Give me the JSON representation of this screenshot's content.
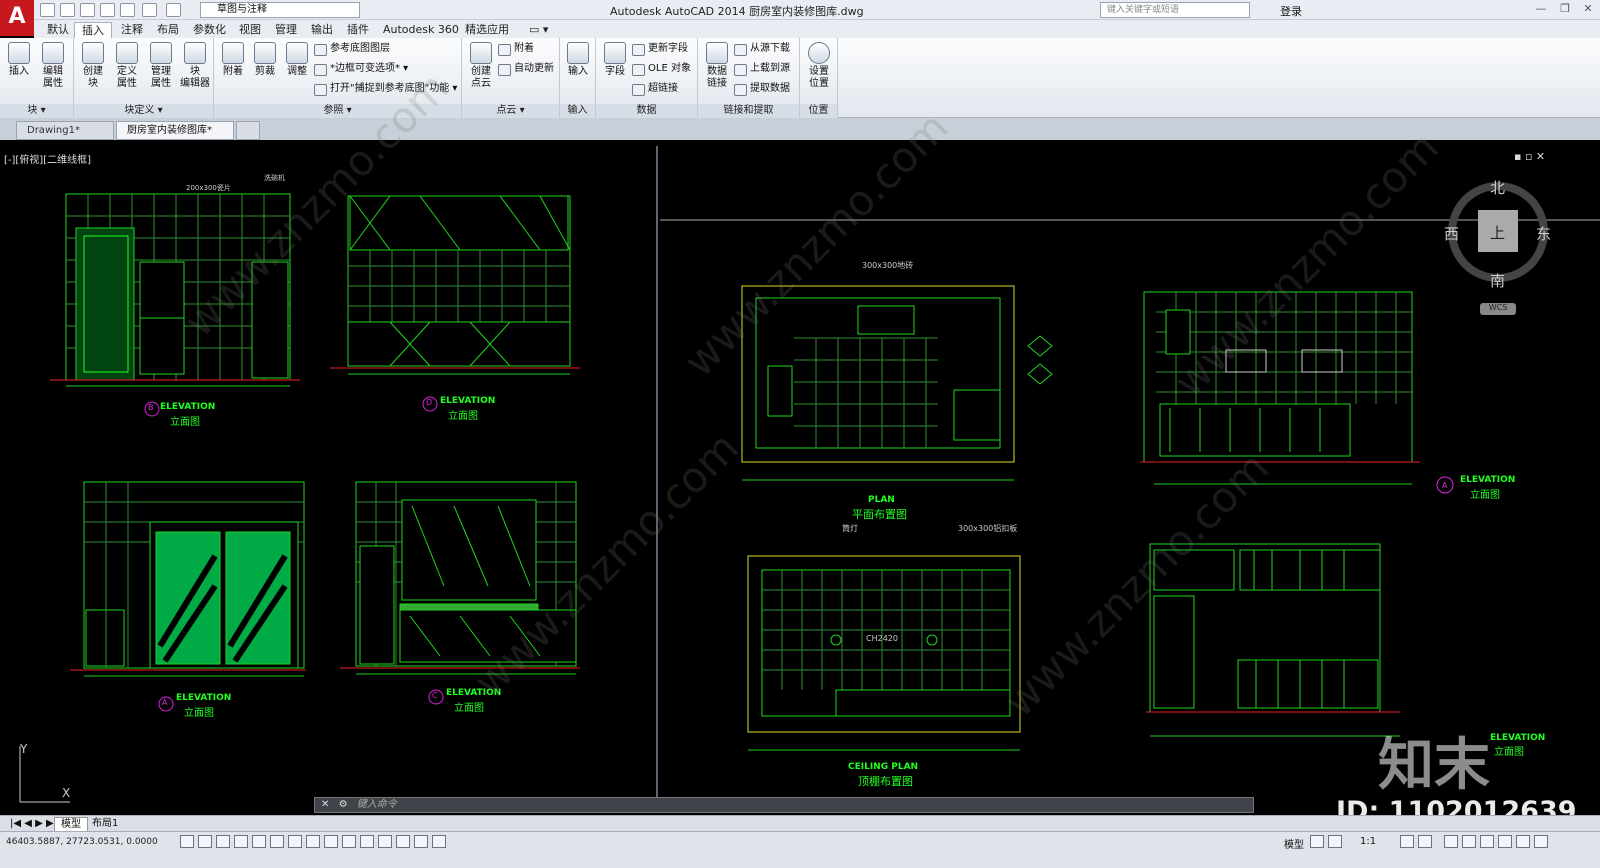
{
  "app": {
    "title": "Autodesk AutoCAD 2014    厨房室内装修图库.dwg",
    "logo": "A",
    "workspace": "草图与注释",
    "search_placeholder": "键入关键字或短语",
    "login": "登录",
    "window_controls": [
      "—",
      "❐",
      "✕"
    ]
  },
  "ribbon_tabs": [
    "默认",
    "插入",
    "注释",
    "布局",
    "参数化",
    "视图",
    "管理",
    "输出",
    "插件",
    "Autodesk 360",
    "精选应用",
    "▭ ▾"
  ],
  "active_ribbon_tab": "插入",
  "panels": {
    "block": {
      "title": "块 ▾",
      "buttons": [
        "插入",
        "编辑\n属性"
      ]
    },
    "block_def": {
      "title": "块定义 ▾",
      "buttons": [
        "创建\n块",
        "定义\n属性",
        "管理\n属性",
        "块\n编辑器"
      ]
    },
    "reference": {
      "title": "参照 ▾",
      "buttons": [
        "附着",
        "剪裁",
        "调整"
      ],
      "small": [
        "参考底图图层",
        "*边框可变选项* ▾",
        "打开\"捕捉到参考底图\"功能 ▾"
      ]
    },
    "pointcloud": {
      "title": "点云 ▾",
      "buttons": [
        "创建\n点云"
      ],
      "small": [
        "附着",
        "自动更新"
      ]
    },
    "import": {
      "title": "输入",
      "buttons": [
        "输入"
      ]
    },
    "data": {
      "title": "数据",
      "buttons": [
        "字段"
      ],
      "small": [
        "更新字段",
        "OLE 对象",
        "超链接"
      ]
    },
    "linking": {
      "title": "链接和提取",
      "buttons": [
        "数据\n链接"
      ],
      "small": [
        "从源下载",
        "上载到源",
        "提取数据"
      ]
    },
    "location": {
      "title": "位置",
      "buttons": [
        "设置\n位置"
      ]
    }
  },
  "doc_tabs": [
    "Drawing1*",
    "厨房室内装修图库*"
  ],
  "active_doc_tab": "厨房室内装修图库*",
  "viewport_label": "[-][俯视][二维线框]",
  "compass": {
    "north": "北",
    "south": "南",
    "east": "东",
    "west": "西",
    "center": "上",
    "wcs": "WCS"
  },
  "drawing_labels": {
    "elev_b": "ELEVATION",
    "elev_b_cn": "立面图",
    "elev_b_mark": "B",
    "elev_d": "ELEVATION",
    "elev_d_cn": "立面图",
    "elev_d_mark": "D",
    "elev_a": "ELEVATION",
    "elev_a_cn": "立面图",
    "elev_a_mark": "A",
    "elev_c": "ELEVATION",
    "elev_c_cn": "立面图",
    "elev_c_mark": "C",
    "plan": "PLAN",
    "plan_cn": "平面布置图",
    "ceiling": "CEILING PLAN",
    "ceiling_cn": "顶棚布置图",
    "elev_r1": "ELEVATION",
    "elev_r1_cn": "立面图",
    "elev_r1_mark": "A",
    "elev_r2": "ELEVATION",
    "elev_r2_cn": "立面图",
    "note_floor": "300x300地砖",
    "note_ceiling": "300x300铝扣板",
    "note_lamp": "筒灯",
    "note_ch": "CH2420",
    "note_tile": "200x300瓷片",
    "note_washer": "洗碗机"
  },
  "command_placeholder": "键入命令",
  "layout_tabs": [
    "模型",
    "布局1"
  ],
  "active_layout_tab": "模型",
  "status": {
    "coords": "46403.5887,  27723.0531,  0.0000",
    "model": "模型",
    "scale": "1:1"
  },
  "watermark": {
    "id": "ID: 1102012639",
    "logo": "知末",
    "site": "www.znzmo.com"
  },
  "axis": {
    "x": "X",
    "y": "Y"
  }
}
